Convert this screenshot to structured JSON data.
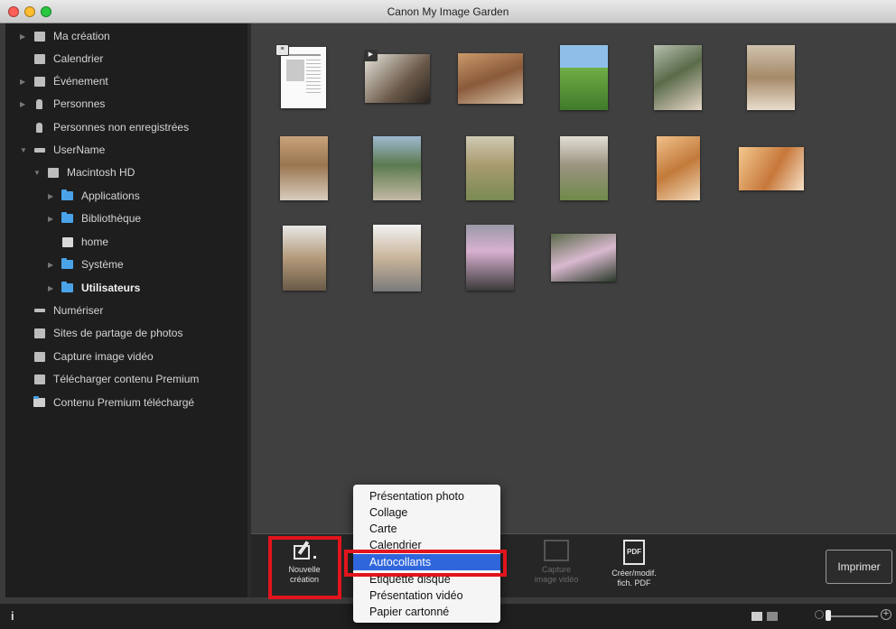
{
  "window": {
    "title": "Canon My Image Garden"
  },
  "traffic_lights": [
    "#fe5f57",
    "#febc2e",
    "#28c840"
  ],
  "sidebar": {
    "items": [
      {
        "label": "Ma création",
        "icon": "my-creation-icon",
        "disclosure": "collapsed"
      },
      {
        "label": "Calendrier",
        "icon": "calendar-icon",
        "disclosure": "none"
      },
      {
        "label": "Événement",
        "icon": "event-icon",
        "disclosure": "collapsed"
      },
      {
        "label": "Personnes",
        "icon": "person-icon",
        "disclosure": "collapsed"
      },
      {
        "label": "Personnes non enregistrées",
        "icon": "unregistered-person-icon",
        "disclosure": "none"
      },
      {
        "label": "UserName",
        "icon": "computer-icon",
        "disclosure": "expanded"
      },
      {
        "label": "Macintosh HD",
        "icon": "hard-drive-icon",
        "disclosure": "expanded"
      },
      {
        "label": "Applications",
        "icon": "folder-icon",
        "disclosure": "collapsed"
      },
      {
        "label": "Bibliothèque",
        "icon": "folder-icon",
        "disclosure": "collapsed"
      },
      {
        "label": "home",
        "icon": "home-folder-icon",
        "disclosure": "none"
      },
      {
        "label": "Système",
        "icon": "folder-icon",
        "disclosure": "collapsed"
      },
      {
        "label": "Utilisateurs",
        "icon": "folder-icon",
        "disclosure": "collapsed",
        "bold": true
      },
      {
        "label": "Numériser",
        "icon": "scan-icon",
        "disclosure": "none"
      },
      {
        "label": "Sites de partage de photos",
        "icon": "photo-sharing-icon",
        "disclosure": "none"
      },
      {
        "label": "Capture image vidéo",
        "icon": "video-capture-icon",
        "disclosure": "none"
      },
      {
        "label": "Télécharger contenu Premium",
        "icon": "download-premium-icon",
        "disclosure": "none"
      },
      {
        "label": "Contenu Premium téléchargé",
        "icon": "premium-folder-icon",
        "disclosure": "none"
      }
    ]
  },
  "thumbnails": [
    {
      "kind": "document",
      "badge": "document-icon"
    },
    {
      "kind": "video",
      "badge": "video-icon"
    },
    {
      "kind": "photo"
    },
    {
      "kind": "photo"
    },
    {
      "kind": "photo"
    },
    {
      "kind": "photo"
    },
    {
      "kind": "photo"
    },
    {
      "kind": "photo"
    },
    {
      "kind": "photo"
    },
    {
      "kind": "photo"
    },
    {
      "kind": "photo"
    },
    {
      "kind": "photo"
    },
    {
      "kind": "photo"
    },
    {
      "kind": "photo"
    },
    {
      "kind": "photo"
    },
    {
      "kind": "photo"
    }
  ],
  "toolbar": {
    "new_creation": {
      "line1": "Nouvelle",
      "line2": "création",
      "icon": "new-creation-icon"
    },
    "capture_video": {
      "line1": "Capture",
      "line2": "image vidéo",
      "icon": "video-capture-icon",
      "enabled": false
    },
    "create_pdf": {
      "line1": "Créer/modif.",
      "line2": "fich. PDF",
      "icon": "pdf-icon"
    },
    "print_label": "Imprimer"
  },
  "menu": {
    "items": [
      {
        "label": "Présentation photo"
      },
      {
        "label": "Collage"
      },
      {
        "label": "Carte"
      },
      {
        "label": "Calendrier"
      },
      {
        "label": "Autocollants",
        "selected": true
      },
      {
        "label": "Etiquette disque"
      },
      {
        "label": "Présentation vidéo"
      },
      {
        "label": "Papier cartonné"
      }
    ]
  },
  "statusbar": {
    "info_icon": "info-icon"
  },
  "colors": {
    "highlight": "#e2141c",
    "menu_selection": "#2f66dc",
    "folder": "#4aa3e8"
  }
}
